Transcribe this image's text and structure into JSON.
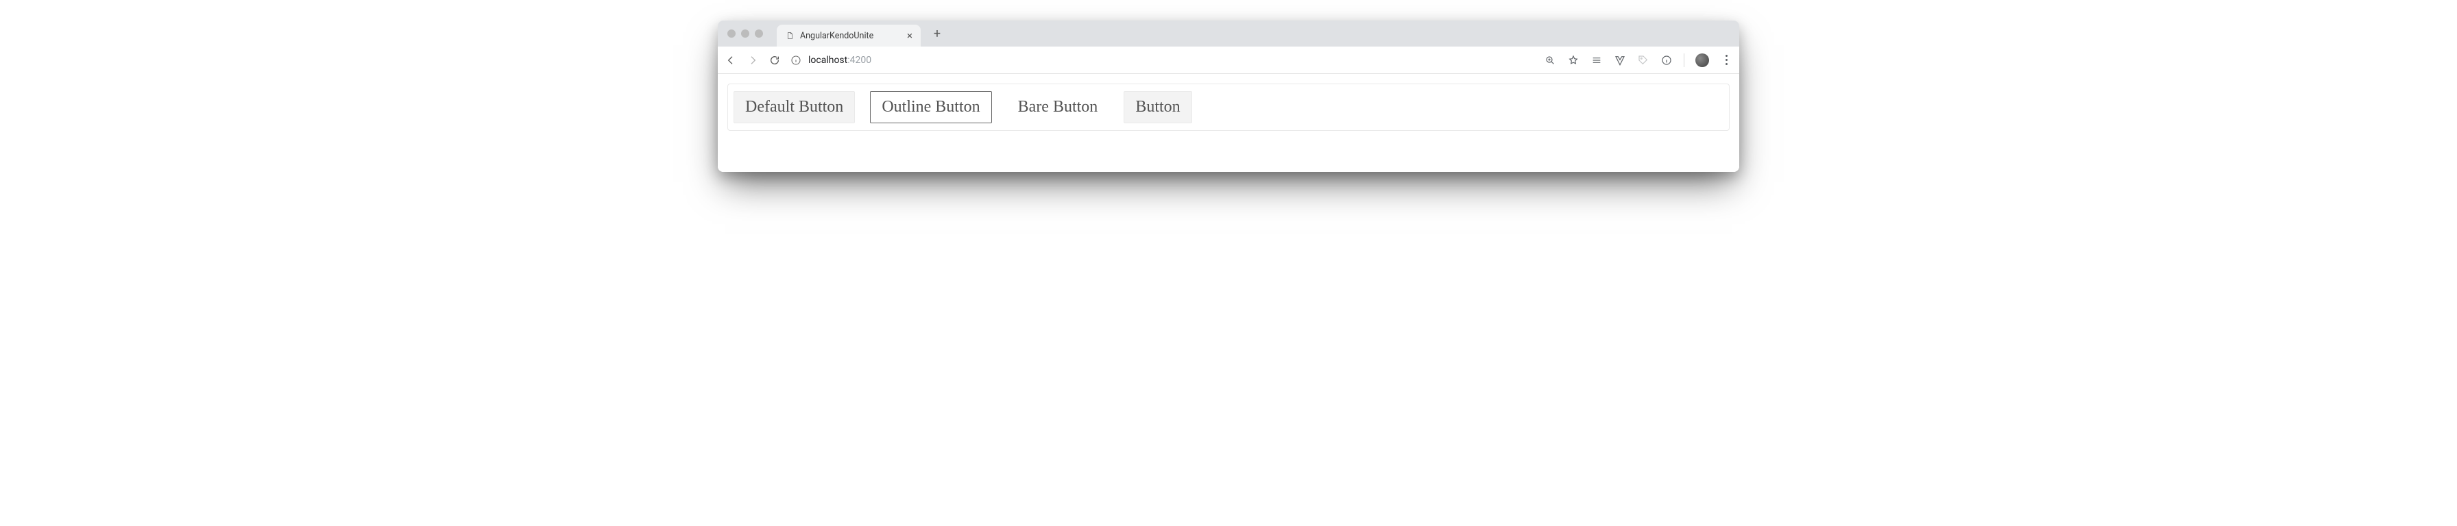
{
  "browser": {
    "tab_title": "AngularKendoUnite",
    "url_host": "localhost",
    "url_port": ":4200"
  },
  "buttons": {
    "default_label": "Default Button",
    "outline_label": "Outline Button",
    "bare_label": "Bare Button",
    "plain_label": "Button"
  }
}
